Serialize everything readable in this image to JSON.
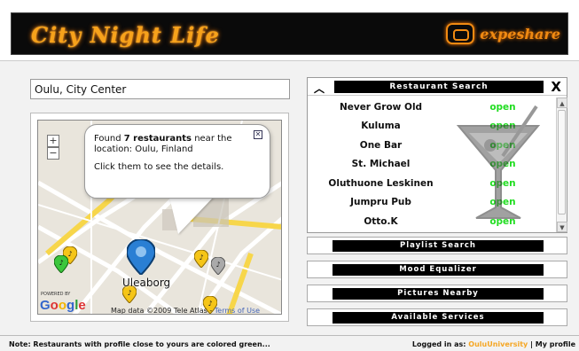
{
  "header": {
    "app_title": "City Night Life",
    "brand": "expeshare"
  },
  "search": {
    "location_value": "Oulu, City Center"
  },
  "map": {
    "zoom_in": "+",
    "zoom_out": "−",
    "bubble": {
      "found_prefix": "Found ",
      "found_count": "7 restaurants",
      "found_suffix": " near the location: Oulu, Finland",
      "hint": "Click them to see the details."
    },
    "city_label": "Uleaborg",
    "powered_by": "POWERED BY",
    "google": "Google",
    "attribution": "Map data ©2009 Tele Atlas - ",
    "terms": "Terms of Use"
  },
  "restaurant_search": {
    "title": "Restaurant Search",
    "close": "X",
    "restaurants": [
      {
        "name": "Never Grow Old",
        "status": "open"
      },
      {
        "name": "Kuluma",
        "status": "open"
      },
      {
        "name": "One Bar",
        "status": "open"
      },
      {
        "name": "St. Michael",
        "status": "open"
      },
      {
        "name": "Oluthuone Leskinen",
        "status": "open"
      },
      {
        "name": "Jumpru Pub",
        "status": "open"
      },
      {
        "name": "Otto.K",
        "status": "open"
      }
    ]
  },
  "menu": {
    "playlist": "Playlist Search",
    "mood": "Mood Equalizer",
    "pictures": "Pictures Nearby",
    "services": "Available Services"
  },
  "footer": {
    "note": "Note: Restaurants with profile close to yours are colored green...",
    "logged_prefix": "Logged in as: ",
    "user": "OuluUniversity",
    "separator": " | ",
    "profile": "My profile"
  },
  "colors": {
    "accent": "#f7a21b",
    "open_status": "#22dd22",
    "header_bg": "#0a0a0a"
  }
}
